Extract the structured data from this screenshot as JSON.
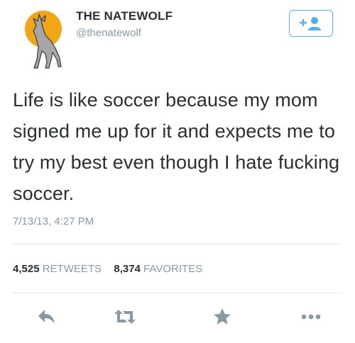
{
  "user": {
    "display_name": "THE NATEWOLF",
    "handle": "@thenatewolf",
    "avatar_icon": "howling-wolf-moon-avatar"
  },
  "follow_button": {
    "icon": "add-user-icon",
    "label": "+"
  },
  "tweet": {
    "text": "Life is like soccer because my mom signed me up for it and expects me to try my best even though I hate fucking soccer.",
    "timestamp": "7/13/13, 4:27 PM"
  },
  "stats": {
    "retweets_count": "4,525",
    "retweets_label": "RETWEETS",
    "favorites_count": "8,374",
    "favorites_label": "FAVORITES"
  },
  "actions": [
    {
      "icon": "reply-icon"
    },
    {
      "icon": "retweet-icon"
    },
    {
      "icon": "favorite-star-icon"
    },
    {
      "icon": "more-dots-icon"
    }
  ],
  "colors": {
    "accent": "#55acee",
    "text": "#292f33",
    "muted": "#8899a6",
    "icon_gray": "#8899a6",
    "divider": "#e1e8ed",
    "moon": "#f2a516"
  }
}
